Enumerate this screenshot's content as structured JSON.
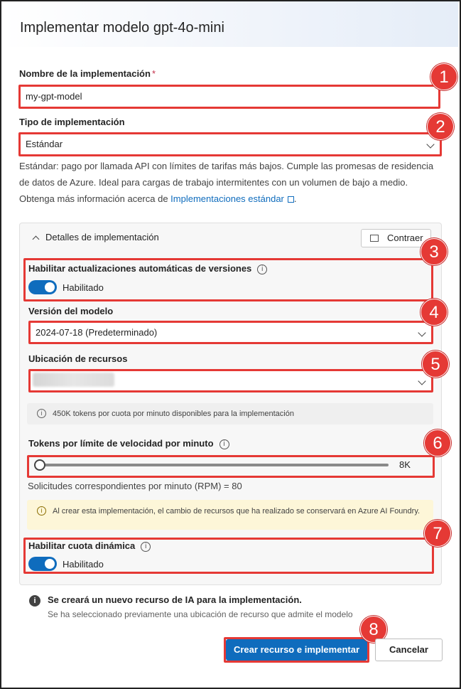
{
  "dialog": {
    "title": "Implementar modelo gpt-4o-mini"
  },
  "deployment_name": {
    "label": "Nombre de la implementación",
    "required_mark": "*",
    "value": "my-gpt-model"
  },
  "deployment_type": {
    "label": "Tipo de implementación",
    "value": "Estándar",
    "description_pre": "Estándar: pago por llamada API con límites de tarifas más bajos. Cumple las promesas de residencia de datos de Azure. Ideal para cargas de trabajo intermitentes con un volumen de bajo a medio. Obtenga más información acerca de ",
    "description_link": "Implementaciones estándar",
    "description_post": "."
  },
  "details": {
    "section_title": "Detalles de implementación",
    "collapse_label": "Contraer",
    "auto_update": {
      "label": "Habilitar actualizaciones automáticas de versiones",
      "state_label": "Habilitado",
      "enabled": true
    },
    "model_version": {
      "label": "Versión del modelo",
      "value": "2024-07-18 (Predeterminado)"
    },
    "resource_location": {
      "label": "Ubicación de recursos",
      "value": ""
    },
    "quota_info": "450K tokens por cuota por minuto disponibles para la implementación",
    "rate_limit": {
      "label": "Tokens por límite de velocidad por minuto",
      "value": "8K",
      "slider_fraction": 0.0
    },
    "rpm_text": "Solicitudes correspondientes por minuto (RPM) = 80",
    "warning_text": "Al crear esta implementación, el cambio de recursos que ha realizado se conservará en Azure AI Foundry.",
    "dynamic_quota": {
      "label": "Habilitar cuota dinámica",
      "state_label": "Habilitado",
      "enabled": true
    }
  },
  "note": {
    "title": "Se creará un nuevo recurso de IA para la implementación.",
    "text": "Se ha seleccionado previamente una ubicación de recurso que admite el modelo"
  },
  "buttons": {
    "primary": "Crear recurso e implementar",
    "secondary": "Cancelar"
  },
  "annotations": [
    "1",
    "2",
    "3",
    "4",
    "5",
    "6",
    "7",
    "8"
  ],
  "colors": {
    "accent": "#0f6cbd",
    "highlight": "#e53935",
    "warning_bg": "#fdf6d8"
  }
}
